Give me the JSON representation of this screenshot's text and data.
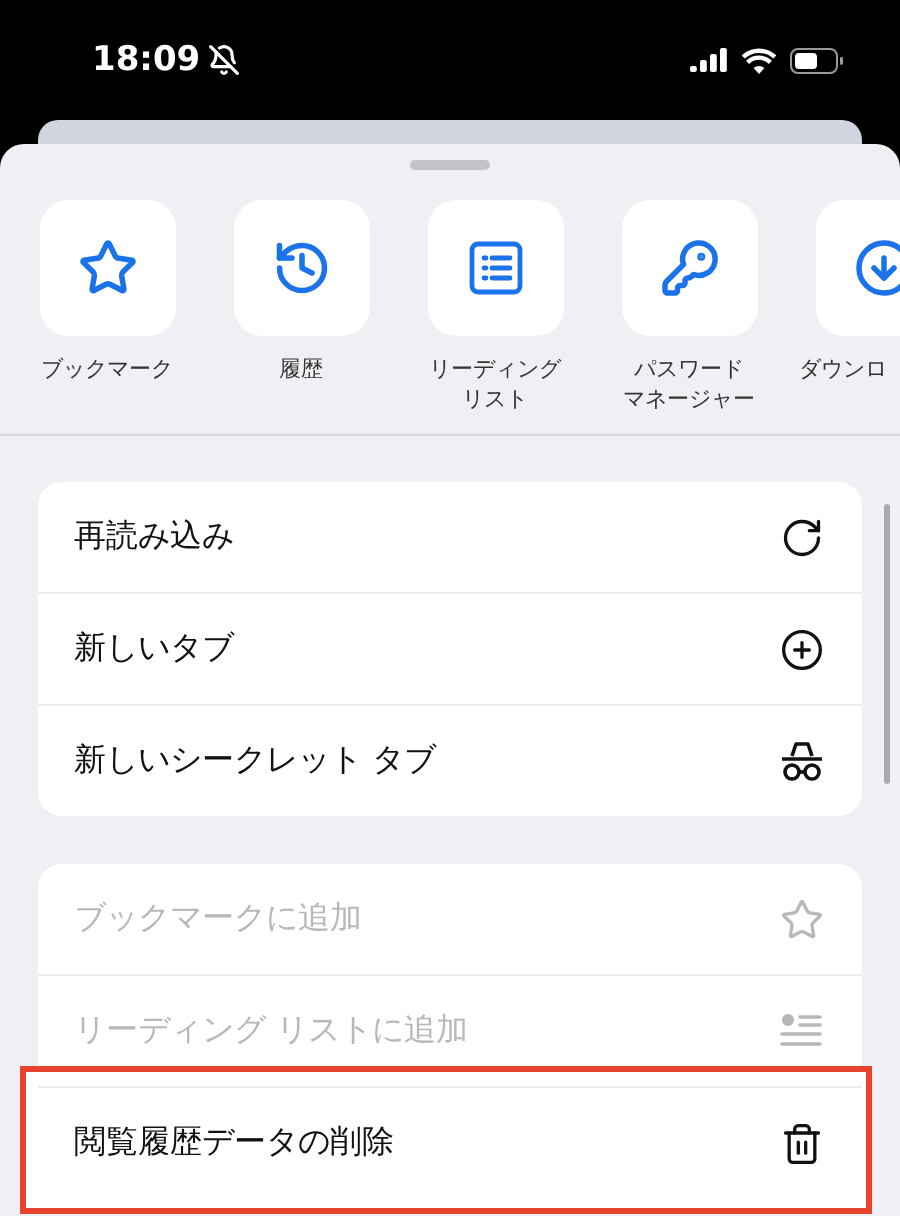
{
  "status_bar": {
    "time": "18:09",
    "silent": true
  },
  "shortcuts": [
    {
      "kind": "star",
      "label_lines": [
        "ブックマーク"
      ]
    },
    {
      "kind": "history",
      "label_lines": [
        "履歴"
      ]
    },
    {
      "kind": "list",
      "label_lines": [
        "リーディング",
        "リスト"
      ]
    },
    {
      "kind": "key",
      "label_lines": [
        "パスワード",
        "マネージャー"
      ]
    },
    {
      "kind": "download",
      "label_lines": [
        "ダウンロ"
      ]
    }
  ],
  "menu_groups": [
    {
      "items": [
        {
          "kind": "reload",
          "label": "再読み込み",
          "disabled": false,
          "highlighted": false
        },
        {
          "kind": "plus",
          "label": "新しいタブ",
          "disabled": false,
          "highlighted": false
        },
        {
          "kind": "incognito",
          "label": "新しいシークレット タブ",
          "disabled": false,
          "highlighted": false
        }
      ]
    },
    {
      "items": [
        {
          "kind": "star",
          "label": "ブックマークに追加",
          "disabled": true,
          "highlighted": false
        },
        {
          "kind": "listadd",
          "label": "リーディング リストに追加",
          "disabled": true,
          "highlighted": false
        },
        {
          "kind": "trash",
          "label": "閲覧履歴データの削除",
          "disabled": false,
          "highlighted": true
        }
      ]
    }
  ]
}
